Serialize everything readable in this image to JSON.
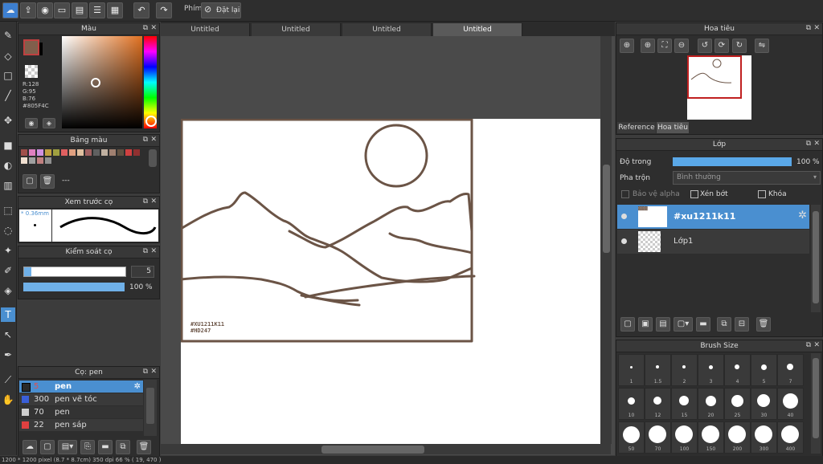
{
  "toolbar": {
    "key_label": "Phím",
    "reset_label": "Đặt lại"
  },
  "tabs": [
    "Untitled",
    "Untitled",
    "Untitled",
    "Untitled"
  ],
  "color_panel": {
    "title": "Màu",
    "r": "R:128",
    "g": "G:95",
    "b": "B:76",
    "hex": "#805F4C",
    "fg_color": "#805f4c",
    "bg_color": "#000000"
  },
  "palette_panel": {
    "title": "Bảng màu",
    "name": "---",
    "colors": [
      "#a0504a",
      "#e080c0",
      "#d090e0",
      "#c0a040",
      "#a0a040",
      "#e06060",
      "#e0a080",
      "#e0c0a0",
      "#a06060",
      "#606060",
      "#c0b0a0",
      "#a08070",
      "#605040",
      "#d04040",
      "#903030",
      "#f0e0d0",
      "#a0a0a0",
      "#c08080",
      "#909090"
    ]
  },
  "preview_panel": {
    "title": "Xem trước cọ",
    "size": "* 0.36mm"
  },
  "brush_control": {
    "title": "Kiểm soát cọ",
    "size_value": "5",
    "opacity_value": "100 %",
    "size_fraction": 0.07,
    "opacity_fraction": 1.0
  },
  "brush_list": {
    "title": "Cọ: pen",
    "items": [
      {
        "size": "5",
        "name": "pen",
        "color": "#2a2a2a"
      },
      {
        "size": "300",
        "name": "pen vẽ tóc",
        "color": "#3a5fd8"
      },
      {
        "size": "70",
        "name": "pen",
        "color": "#d0d0d0"
      },
      {
        "size": "22",
        "name": "pen sáp",
        "color": "#e04040"
      }
    ]
  },
  "navigator": {
    "title": "Hoa tiêu",
    "tab_reference": "Reference",
    "tab_navigator": "Hoa tiêu"
  },
  "layer_panel": {
    "title": "Lớp",
    "opacity_label": "Độ trong",
    "opacity_value": "100 %",
    "opacity_fraction": 1.0,
    "blend_label": "Pha trộn",
    "blend_value": "Bình thường",
    "protect_alpha": "Bảo vệ alpha",
    "clipping": "Xén bớt",
    "lock": "Khóa",
    "layers": [
      {
        "name": "#xu1211k11",
        "selected": true
      },
      {
        "name": "Lớp1",
        "selected": false
      }
    ]
  },
  "brush_size": {
    "title": "Brush Size",
    "sizes": [
      "1",
      "1.5",
      "2",
      "3",
      "4",
      "5",
      "7",
      "10",
      "12",
      "15",
      "20",
      "25",
      "30",
      "40",
      "50",
      "70",
      "100",
      "150",
      "200",
      "300",
      "400"
    ]
  },
  "canvas_text": {
    "line1": "#XU1211K11",
    "line2": "#HD247"
  },
  "status": {
    "text": "1200 * 1200 pixel  (8.7 * 8.7cm)  350 dpi  66 %  ( 19, 470 )"
  },
  "colors": {
    "accent": "#4a8fd0",
    "ink": "#6b5446"
  }
}
